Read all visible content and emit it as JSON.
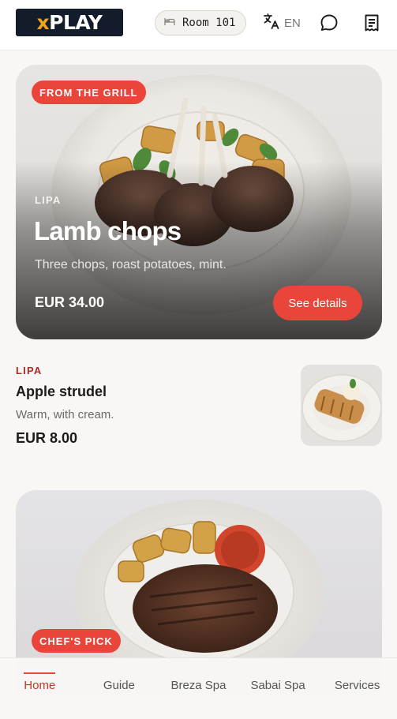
{
  "header": {
    "logo": {
      "prefix": "x",
      "main": "PLAY"
    },
    "room_label": "Room 101",
    "language_label": "EN",
    "icons": [
      "bed-icon",
      "translate-icon",
      "chat-icon",
      "receipt-icon"
    ]
  },
  "hero": {
    "badge": "FROM THE GRILL",
    "venue": "LIPA",
    "title": "Lamb chops",
    "description": "Three chops, roast potatoes, mint.",
    "price": "EUR 34.00",
    "button_label": "See details"
  },
  "item": {
    "venue": "LIPA",
    "title": "Apple strudel",
    "description": "Warm, with cream.",
    "price": "EUR 8.00"
  },
  "card2": {
    "badge": "CHEF'S PICK"
  },
  "nav": {
    "items": [
      {
        "label": "Home",
        "active": true
      },
      {
        "label": "Guide",
        "active": false
      },
      {
        "label": "Breza Spa",
        "active": false
      },
      {
        "label": "Sabai Spa",
        "active": false
      },
      {
        "label": "Services",
        "active": false
      }
    ]
  },
  "colors": {
    "accent": "#e9453a",
    "accent_text": "#b02a25",
    "logo_bg": "#121c2b",
    "logo_x": "#f0a21d",
    "background": "#f8f7f5"
  }
}
